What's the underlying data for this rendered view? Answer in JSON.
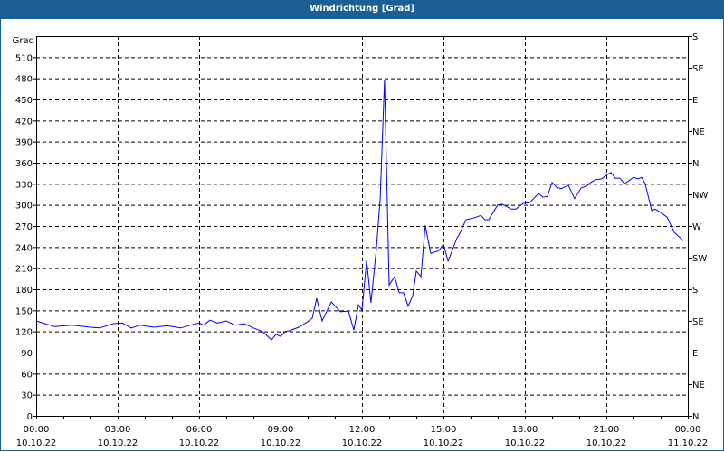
{
  "window": {
    "title": "Windrichtung [Grad]"
  },
  "colors": {
    "titlebar": "#1c5f96",
    "line": "#0000ff",
    "grid": "#000000"
  },
  "chart_data": {
    "type": "line",
    "title": "Windrichtung [Grad]",
    "ylabel": "Grad",
    "ylim": [
      0,
      540
    ],
    "yticks": [
      0,
      30,
      60,
      90,
      120,
      150,
      180,
      210,
      240,
      270,
      300,
      330,
      360,
      390,
      420,
      450,
      480,
      510
    ],
    "xlim_hours": [
      0,
      24
    ],
    "xticks": [
      {
        "h": 0,
        "time": "00:00",
        "date": "10.10.22"
      },
      {
        "h": 3,
        "time": "03:00",
        "date": "10.10.22"
      },
      {
        "h": 6,
        "time": "06:00",
        "date": "10.10.22"
      },
      {
        "h": 9,
        "time": "09:00",
        "date": "10.10.22"
      },
      {
        "h": 12,
        "time": "12:00",
        "date": "10.10.22"
      },
      {
        "h": 15,
        "time": "15:00",
        "date": "10.10.22"
      },
      {
        "h": 18,
        "time": "18:00",
        "date": "10.10.22"
      },
      {
        "h": 21,
        "time": "21:00",
        "date": "10.10.22"
      },
      {
        "h": 24,
        "time": "00:00",
        "date": "11.10.22"
      }
    ],
    "right_axis": [
      {
        "v": 0,
        "label": "N"
      },
      {
        "v": 45,
        "label": "NE"
      },
      {
        "v": 90,
        "label": "E"
      },
      {
        "v": 135,
        "label": "SE"
      },
      {
        "v": 180,
        "label": "S"
      },
      {
        "v": 225,
        "label": "SW"
      },
      {
        "v": 270,
        "label": "W"
      },
      {
        "v": 315,
        "label": "NW"
      },
      {
        "v": 360,
        "label": "N"
      },
      {
        "v": 405,
        "label": "NE"
      },
      {
        "v": 450,
        "label": "E"
      },
      {
        "v": 495,
        "label": "SE"
      },
      {
        "v": 540,
        "label": "S"
      }
    ],
    "grid": true,
    "series": [
      {
        "name": "Windrichtung",
        "x_hours": [
          0,
          0.33,
          0.67,
          1.33,
          2,
          2.33,
          2.83,
          3.17,
          3.5,
          3.83,
          4.33,
          4.83,
          5.33,
          5.67,
          6,
          6.17,
          6.4,
          6.67,
          7,
          7.33,
          7.67,
          8,
          8.33,
          8.67,
          8.83,
          9,
          9.17,
          9.33,
          9.67,
          10,
          10.17,
          10.33,
          10.53,
          10.87,
          11.2,
          11.5,
          11.7,
          11.87,
          12,
          12.17,
          12.33,
          12.53,
          12.67,
          12.83,
          13,
          13.2,
          13.37,
          13.53,
          13.7,
          13.87,
          14,
          14.17,
          14.33,
          14.53,
          14.83,
          15,
          15.17,
          15.5,
          15.57,
          15.83,
          16.17,
          16.37,
          16.53,
          16.67,
          17,
          17.17,
          17.5,
          17.67,
          17.93,
          18.17,
          18.5,
          18.67,
          18.83,
          19,
          19.17,
          19.33,
          19.6,
          19.83,
          20.07,
          20.27,
          20.43,
          20.6,
          20.83,
          21.03,
          21.17,
          21.33,
          21.5,
          21.67,
          22,
          22.17,
          22.3,
          22.43,
          22.67,
          22.8,
          23,
          23.23,
          23.5,
          23.83
        ],
        "values": [
          135,
          131,
          127,
          129,
          126,
          125,
          131,
          132,
          125,
          129,
          126,
          128,
          125,
          129,
          132,
          129,
          136,
          132,
          135,
          129,
          131,
          125,
          120,
          108,
          116,
          113,
          120,
          121,
          126,
          134,
          139,
          167,
          135,
          162,
          148,
          149,
          122,
          158,
          150,
          221,
          161,
          238,
          309,
          478,
          186,
          198,
          175,
          175,
          156,
          171,
          206,
          198,
          271,
          231,
          235,
          244,
          220,
          253,
          257,
          279,
          282,
          285,
          279,
          279,
          300,
          301,
          294,
          294,
          302,
          303,
          316,
          311,
          312,
          332,
          325,
          323,
          328,
          309,
          324,
          327,
          332,
          336,
          337,
          343,
          346,
          338,
          338,
          330,
          339,
          337,
          339,
          330,
          292,
          294,
          289,
          283,
          261,
          249
        ]
      }
    ]
  }
}
